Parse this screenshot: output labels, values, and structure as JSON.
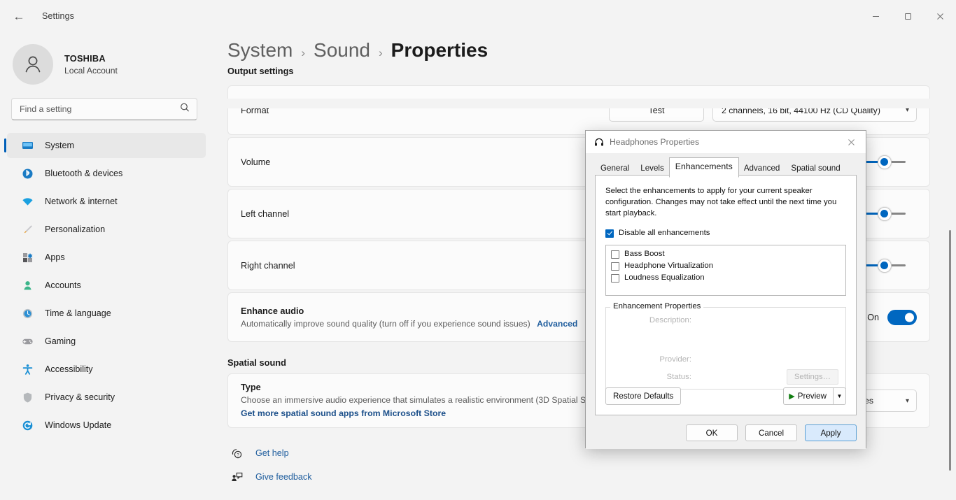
{
  "titlebar": {
    "back_label": "←",
    "app_title": "Settings",
    "minimize": "—",
    "maximize": "□",
    "close": "✕"
  },
  "sidebar": {
    "account": {
      "name": "TOSHIBA",
      "subtitle": "Local Account"
    },
    "search": {
      "placeholder": "Find a setting",
      "value": ""
    },
    "items": [
      {
        "label": "System",
        "icon": "monitor-icon",
        "active": true
      },
      {
        "label": "Bluetooth & devices",
        "icon": "bluetooth-icon",
        "active": false
      },
      {
        "label": "Network & internet",
        "icon": "wifi-icon",
        "active": false
      },
      {
        "label": "Personalization",
        "icon": "brush-icon",
        "active": false
      },
      {
        "label": "Apps",
        "icon": "apps-icon",
        "active": false
      },
      {
        "label": "Accounts",
        "icon": "person-icon",
        "active": false
      },
      {
        "label": "Time & language",
        "icon": "clock-icon",
        "active": false
      },
      {
        "label": "Gaming",
        "icon": "gamepad-icon",
        "active": false
      },
      {
        "label": "Accessibility",
        "icon": "accessibility-icon",
        "active": false
      },
      {
        "label": "Privacy & security",
        "icon": "shield-icon",
        "active": false
      },
      {
        "label": "Windows Update",
        "icon": "update-icon",
        "active": false
      }
    ]
  },
  "breadcrumb": {
    "root": "System",
    "middle": "Sound",
    "current": "Properties",
    "separator": "›"
  },
  "main": {
    "output_settings_heading": "Output settings",
    "format": {
      "label": "Format",
      "test_button": "Test",
      "value": "2 channels, 16 bit, 44100 Hz (CD Quality)"
    },
    "volume": {
      "label": "Volume"
    },
    "left_channel": {
      "label": "Left channel"
    },
    "right_channel": {
      "label": "Right channel"
    },
    "enhance_audio": {
      "title": "Enhance audio",
      "desc": "Automatically improve sound quality (turn off if you experience sound issues)",
      "advanced_link": "Advanced",
      "toggle_state": "On"
    },
    "spatial_sound_heading": "Spatial sound",
    "spatial": {
      "title": "Type",
      "desc": "Choose an immersive audio experience that simulates a realistic environment (3D Spatial So",
      "store_link": "Get more spatial sound apps from Microsoft Store",
      "value": "…ones"
    },
    "footer": [
      {
        "label": "Get help",
        "icon": "help-icon"
      },
      {
        "label": "Give feedback",
        "icon": "feedback-icon"
      }
    ]
  },
  "dialog": {
    "title": "Headphones Properties",
    "icon": "headphones-icon",
    "close": "✕",
    "tabs": [
      {
        "label": "General",
        "active": false
      },
      {
        "label": "Levels",
        "active": false
      },
      {
        "label": "Enhancements",
        "active": true
      },
      {
        "label": "Advanced",
        "active": false
      },
      {
        "label": "Spatial sound",
        "active": false
      }
    ],
    "description": "Select the enhancements to apply for your current speaker configuration. Changes may not take effect until the next time you start playback.",
    "disable_all": {
      "label": "Disable all enhancements",
      "checked": true
    },
    "enhancements": [
      {
        "label": "Bass Boost",
        "checked": false
      },
      {
        "label": "Headphone Virtualization",
        "checked": false
      },
      {
        "label": "Loudness Equalization",
        "checked": false
      }
    ],
    "properties_group": {
      "title": "Enhancement Properties",
      "description_label": "Description:",
      "description_value": "",
      "provider_label": "Provider:",
      "provider_value": "",
      "status_label": "Status:",
      "status_value": "",
      "settings_button": "Settings…"
    },
    "restore_defaults": "Restore Defaults",
    "preview": {
      "label": "Preview",
      "play_glyph": "▶",
      "dropdown_glyph": "▼"
    },
    "actions": {
      "ok": "OK",
      "cancel": "Cancel",
      "apply": "Apply"
    }
  },
  "colors": {
    "accent": "#0067c0",
    "link": "#205e9e",
    "window_bg": "#f3f3f3",
    "card_bg": "#fbfbfb",
    "dialog_bg": "#f0f0f0"
  }
}
